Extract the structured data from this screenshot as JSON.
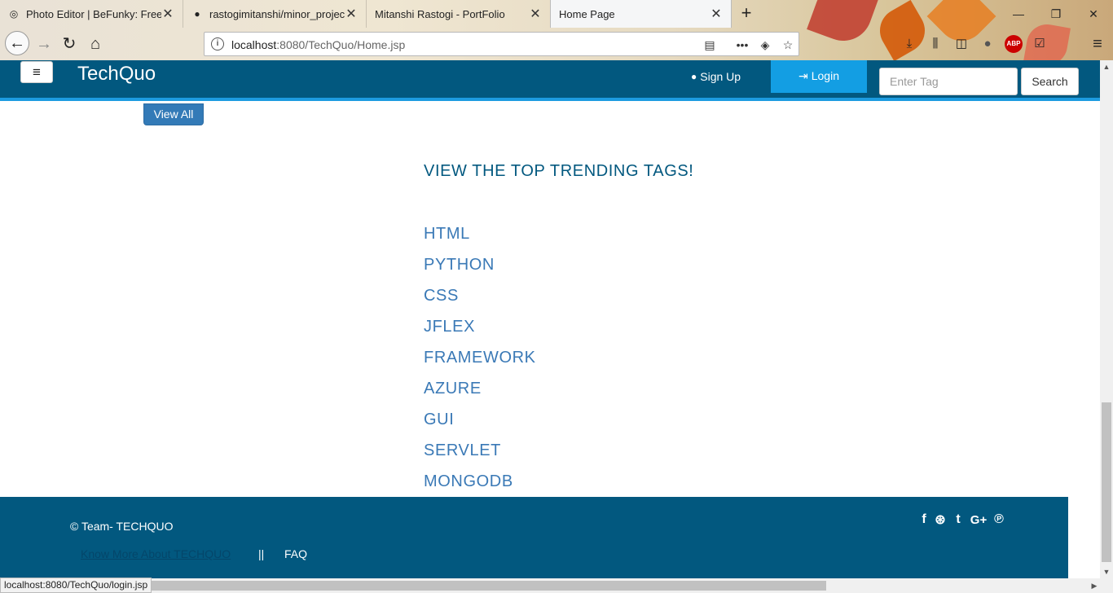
{
  "browser": {
    "tabs": [
      {
        "title": "Photo Editor | BeFunky: Free On",
        "favicon": "befunky-icon"
      },
      {
        "title": "rastogimitanshi/minor_project",
        "favicon": "github-icon"
      },
      {
        "title": "Mitanshi Rastogi - PortFolio",
        "favicon": "page-icon"
      },
      {
        "title": "Home Page",
        "favicon": "page-icon"
      }
    ],
    "url_host": "localhost",
    "url_path": ":8080/TechQuo/Home.jsp",
    "status_url": "localhost:8080/TechQuo/login.jsp",
    "icons": {
      "back": "←",
      "forward": "→",
      "reload": "↻",
      "home": "⌂",
      "info": "i",
      "reader": "▤",
      "more": "•••",
      "pocket": "◈",
      "bookmark": "☆",
      "download": "⤓",
      "library": "⫼",
      "sidebar": "◫",
      "extension": "●",
      "abp": "ABP",
      "tick": "☑",
      "menu": "≡",
      "new_tab": "+",
      "close": "✕",
      "minimize": "—",
      "restore": "❐",
      "win_close": "✕"
    }
  },
  "header": {
    "brand": "TechQuo",
    "menu_icon": "≡",
    "signup_label": "Sign Up",
    "login_label": "Login",
    "search_placeholder": "Enter Tag",
    "search_label": "Search",
    "user_icon": "👤",
    "login_icon": "⇥"
  },
  "view_all_label": "View All",
  "trending": {
    "title": "VIEW THE TOP TRENDING TAGS!",
    "tags": [
      "HTML",
      "PYTHON",
      "CSS",
      "JFLEX",
      "FRAMEWORK",
      "AZURE",
      "GUI",
      "SERVLET",
      "MONGODB"
    ]
  },
  "footer": {
    "copyright": "© Team- TECHQUO",
    "know_more": "Know More About TECHQUO",
    "divider": "||",
    "faq": "FAQ",
    "social": [
      "f",
      "⊛",
      "t",
      "G+",
      "℗"
    ]
  },
  "colors": {
    "header_bg": "#02587f",
    "header_accent": "#1d9be0",
    "login_bg": "#139ee3",
    "tag_link": "#3a79b6",
    "view_all_bg": "#337ab7"
  }
}
